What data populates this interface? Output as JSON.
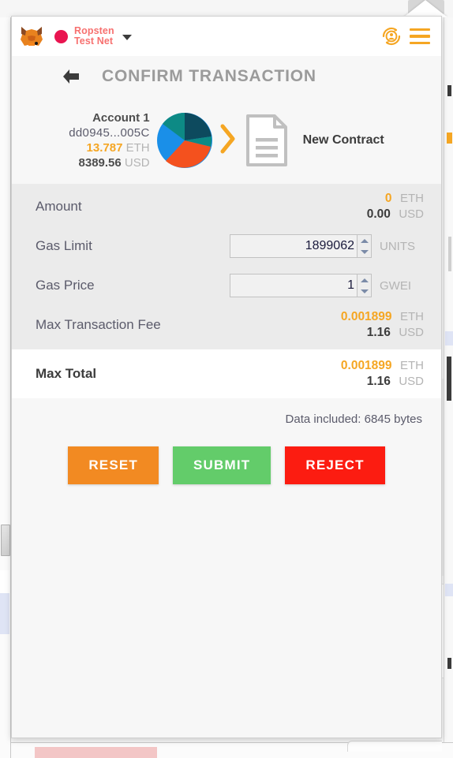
{
  "header": {
    "logo_icon": "metamask-fox-icon",
    "network": {
      "name": "Ropsten\nTest Net",
      "dot_color": "#e91550",
      "text_color": "#f77170",
      "caret_icon": "chevron-down-icon"
    },
    "account_switch_icon": "account-switch-icon",
    "menu_icon": "hamburger-menu-icon"
  },
  "title_bar": {
    "back_icon": "back-arrow-icon",
    "title": "CONFIRM TRANSACTION"
  },
  "route": {
    "from": {
      "account_name": "Account 1",
      "address": "dd0945...005C",
      "balance_eth": "13.787",
      "balance_eth_unit": "ETH",
      "balance_usd": "8389.56",
      "balance_usd_unit": "USD",
      "identicon": "pie-identicon"
    },
    "separator_icon": "chevron-right-icon",
    "to": {
      "icon": "contract-document-icon",
      "label": "New Contract"
    }
  },
  "details": {
    "rows": [
      {
        "label": "Amount",
        "primary": "0",
        "primary_unit": "ETH",
        "secondary": "0.00",
        "secondary_unit": "USD"
      },
      {
        "label": "Gas Limit",
        "input_value": "1899062",
        "unit": "UNITS"
      },
      {
        "label": "Gas Price",
        "input_value": "1",
        "unit": "GWEI"
      },
      {
        "label": "Max Transaction Fee",
        "primary": "0.001899",
        "primary_unit": "ETH",
        "secondary": "1.16",
        "secondary_unit": "USD"
      }
    ],
    "total": {
      "label": "Max Total",
      "primary": "0.001899",
      "primary_unit": "ETH",
      "secondary": "1.16",
      "secondary_unit": "USD"
    },
    "data_note": "Data included: 6845 bytes"
  },
  "actions": {
    "reset": "RESET",
    "submit": "SUBMIT",
    "reject": "REJECT",
    "reset_color": "#f28a22",
    "submit_color": "#63cc6a",
    "reject_color": "#fc1c11"
  }
}
